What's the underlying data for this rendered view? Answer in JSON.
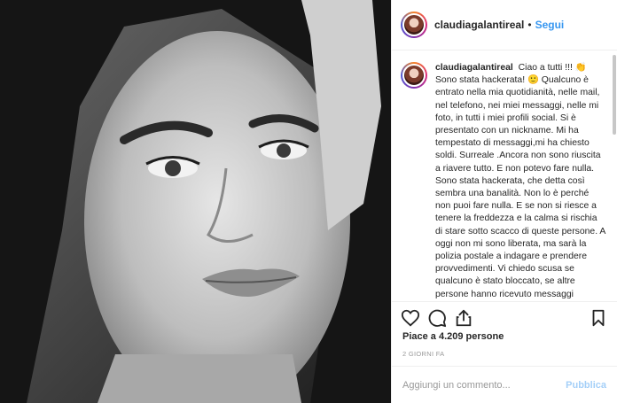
{
  "post": {
    "photo_alt": "Black and white close-up portrait"
  },
  "header": {
    "username": "claudiagalantireal",
    "separator": "•",
    "follow_label": "Segui"
  },
  "caption": {
    "username": "claudiagalantireal",
    "text": "Ciao a tutti !!! 👏 Sono stata hackerata! 🙂 Qualcuno è entrato nella mia quotidianità, nelle mail, nel telefono, nei miei messaggi, nelle mi foto, in tutti i miei profili social. Si è presentato con un nickname. Mi ha tempestato di messaggi,mi ha chiesto soldi. Surreale .Ancora non sono riuscita a riavere tutto. E non potevo fare nulla. Sono stata hackerata, che detta così sembra una banalità. Non lo è perché non puoi fare nulla. E se non si riesce a tenere la freddezza e la calma si rischia di stare sotto scacco di queste persone. A oggi non mi sono liberata, ma sarà la polizia postale a indagare e prendere provvedimenti. Vi chiedo scusa se qualcuno è stato bloccato, se altre persone hanno ricevuto messaggi"
  },
  "actions": {
    "like_icon": "heart-icon",
    "comment_icon": "comment-icon",
    "share_icon": "share-icon",
    "save_icon": "bookmark-icon"
  },
  "likes": {
    "text": "Piace a 4.209 persone"
  },
  "timestamp": "2 GIORNI FA",
  "add_comment": {
    "placeholder": "Aggiungi un commento...",
    "publish_label": "Pubblica"
  },
  "colors": {
    "accent": "#3897f0",
    "text": "#262626",
    "muted": "#999999",
    "border": "#efefef"
  }
}
